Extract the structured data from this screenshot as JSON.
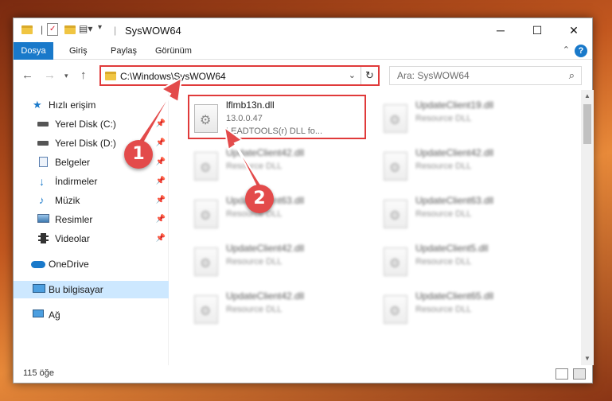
{
  "window": {
    "title": "SysWOW64",
    "controls": {
      "minimize": "─",
      "maximize": "☐",
      "close": "✕"
    }
  },
  "ribbon": {
    "tabs": [
      "Dosya",
      "Giriş",
      "Paylaş",
      "Görünüm"
    ],
    "collapse_icon": "chevron-up-icon",
    "help_icon": "?"
  },
  "address": {
    "path": "C:\\Windows\\SysWOW64",
    "search_placeholder": "Ara: SysWOW64"
  },
  "nav": {
    "items": [
      {
        "label": "Hızlı erişim",
        "icon": "star-icon",
        "pinned": false
      },
      {
        "label": "Yerel Disk (C:)",
        "icon": "drive-icon",
        "pinned": true
      },
      {
        "label": "Yerel Disk (D:)",
        "icon": "drive-icon",
        "pinned": true
      },
      {
        "label": "Belgeler",
        "icon": "documents-icon",
        "pinned": true
      },
      {
        "label": "İndirmeler",
        "icon": "download-icon",
        "pinned": true
      },
      {
        "label": "Müzik",
        "icon": "music-icon",
        "pinned": true
      },
      {
        "label": "Resimler",
        "icon": "pictures-icon",
        "pinned": true
      },
      {
        "label": "Videolar",
        "icon": "videos-icon",
        "pinned": true
      },
      {
        "label": "OneDrive",
        "icon": "onedrive-icon",
        "pinned": false
      },
      {
        "label": "Bu bilgisayar",
        "icon": "computer-icon",
        "pinned": false
      },
      {
        "label": "Ağ",
        "icon": "network-icon",
        "pinned": false
      }
    ]
  },
  "files": {
    "highlighted": {
      "name": "lflmb13n.dll",
      "version": "13.0.0.47",
      "description": "LEADTOOLS(r) DLL fo..."
    },
    "left_column": [
      {
        "name": "UpdateClient42.dll",
        "type": "Resource DLL"
      },
      {
        "name": "UpdateClient63.dll",
        "type": "Resource DLL"
      },
      {
        "name": "UpdateClient42.dll",
        "type": "Resource DLL"
      },
      {
        "name": "UpdateClient42.dll",
        "type": "Resource DLL"
      }
    ],
    "right_column": [
      {
        "name": "UpdateClient19.dll",
        "type": "Resource DLL"
      },
      {
        "name": "UpdateClient42.dll",
        "type": "Resource DLL"
      },
      {
        "name": "UpdateClient63.dll",
        "type": "Resource DLL"
      },
      {
        "name": "UpdateClient5.dll",
        "type": "Resource DLL"
      },
      {
        "name": "UpdateClient65.dll",
        "type": "Resource DLL"
      }
    ]
  },
  "status": {
    "count": "115 öğe"
  },
  "annotations": {
    "step1": "1",
    "step2": "2",
    "color": "#e34b4b"
  }
}
